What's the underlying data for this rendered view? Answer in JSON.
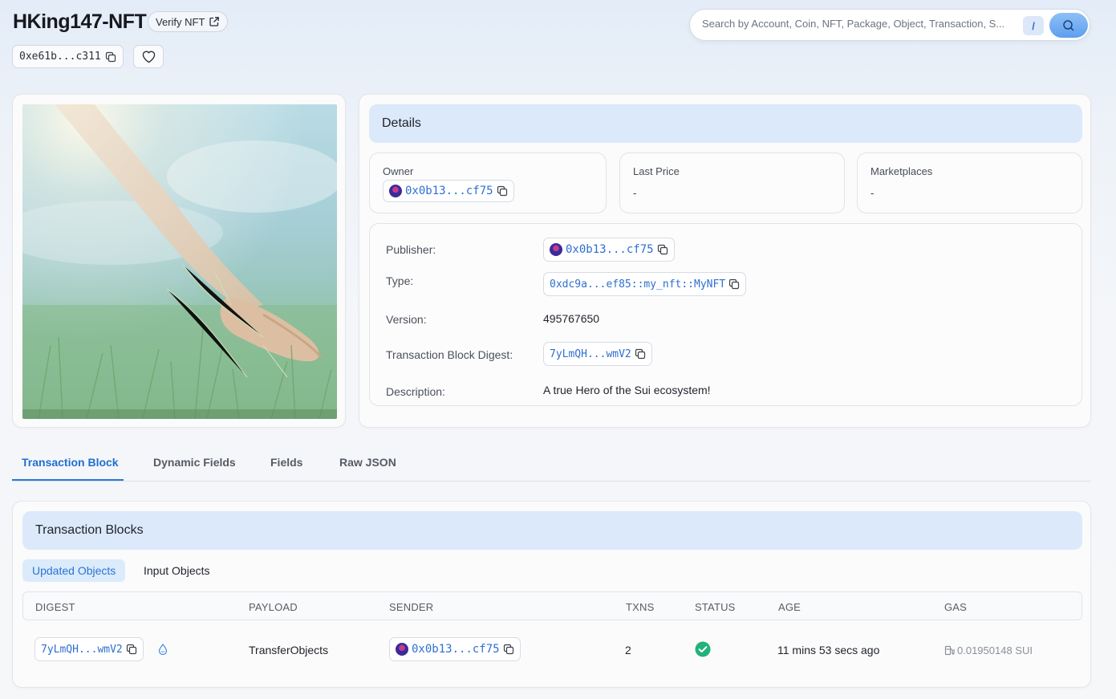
{
  "header": {
    "title": "HKing147-NFT",
    "verify_label": "Verify NFT",
    "object_address": "0xe61b...c311"
  },
  "search": {
    "placeholder": "Search by Account, Coin, NFT, Package, Object, Transaction, S...",
    "shortcut": "/"
  },
  "details": {
    "heading": "Details",
    "owner_label": "Owner",
    "owner_address": "0x0b13...cf75",
    "last_price_label": "Last Price",
    "last_price_value": "-",
    "marketplaces_label": "Marketplaces",
    "marketplaces_value": "-",
    "publisher_label": "Publisher:",
    "publisher_address": "0x0b13...cf75",
    "type_label": "Type:",
    "type_value": "0xdc9a...ef85::my_nft::MyNFT",
    "version_label": "Version:",
    "version_value": "495767650",
    "digest_label": "Transaction Block Digest:",
    "digest_value": "7yLmQH...wmV2",
    "description_label": "Description:",
    "description_value": "A true Hero of the Sui ecosystem!"
  },
  "tabs": [
    "Transaction Block",
    "Dynamic Fields",
    "Fields",
    "Raw JSON"
  ],
  "transactions": {
    "heading": "Transaction Blocks",
    "subtabs": [
      "Updated Objects",
      "Input Objects"
    ],
    "columns": [
      "DIGEST",
      "PAYLOAD",
      "SENDER",
      "TXNS",
      "STATUS",
      "AGE",
      "GAS"
    ],
    "rows": [
      {
        "digest": "7yLmQH...wmV2",
        "payload": "TransferObjects",
        "sender": "0x0b13...cf75",
        "txns": "2",
        "status": "success",
        "age": "11 mins 53 secs ago",
        "gas": "0.01950148 SUI"
      }
    ]
  },
  "colors": {
    "accent": "#2a78d8",
    "link": "#2e6fd1",
    "section_bg": "#dbe9fb",
    "success": "#22b27a"
  }
}
